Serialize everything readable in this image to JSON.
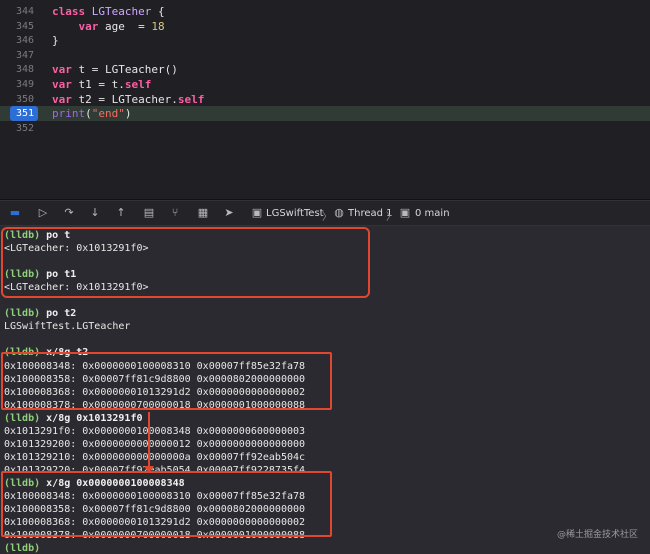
{
  "editor": {
    "lines": [
      {
        "num": "344",
        "tokens": [
          [
            "kw",
            "class "
          ],
          [
            "ty",
            "LGTeacher"
          ],
          [
            "plain",
            " {"
          ]
        ]
      },
      {
        "num": "345",
        "tokens": [
          [
            "plain",
            "    "
          ],
          [
            "kw",
            "var "
          ],
          [
            "plain",
            "age  = "
          ],
          [
            "nm",
            "18"
          ]
        ]
      },
      {
        "num": "346",
        "tokens": [
          [
            "plain",
            "}"
          ]
        ]
      },
      {
        "num": "347",
        "tokens": []
      },
      {
        "num": "348",
        "tokens": [
          [
            "kw",
            "var "
          ],
          [
            "plain",
            "t = LGTeacher()"
          ]
        ]
      },
      {
        "num": "349",
        "tokens": [
          [
            "kw",
            "var "
          ],
          [
            "plain",
            "t1 = t."
          ],
          [
            "kw",
            "self"
          ]
        ]
      },
      {
        "num": "350",
        "tokens": [
          [
            "kw",
            "var "
          ],
          [
            "plain",
            "t2 = LGTeacher."
          ],
          [
            "kw",
            "self"
          ]
        ]
      },
      {
        "num": "351",
        "active": true,
        "tokens": [
          [
            "fn",
            "print"
          ],
          [
            "plain",
            "("
          ],
          [
            "str",
            "\"end\""
          ],
          [
            "plain",
            ")"
          ]
        ]
      },
      {
        "num": "352",
        "tokens": []
      }
    ]
  },
  "debugbar": {
    "target": "LGSwiftTest",
    "thread": "Thread 1",
    "frame": "0 main",
    "sep1": "〉",
    "sep2": "〉"
  },
  "console": {
    "prompt": "(lldb)",
    "lines": [
      {
        "type": "cmd",
        "text": "po t"
      },
      {
        "type": "out",
        "text": "<LGTeacher: 0x1013291f0>"
      },
      {
        "type": "blank",
        "text": ""
      },
      {
        "type": "cmd",
        "text": "po t1"
      },
      {
        "type": "out",
        "text": "<LGTeacher: 0x1013291f0>"
      },
      {
        "type": "blank",
        "text": ""
      },
      {
        "type": "cmd",
        "text": "po t2"
      },
      {
        "type": "out",
        "text": "LGSwiftTest.LGTeacher"
      },
      {
        "type": "blank",
        "text": ""
      },
      {
        "type": "cmd",
        "text": "x/8g t2"
      },
      {
        "type": "out",
        "text": "0x100008348: 0x0000000100008310 0x00007ff85e32fa78"
      },
      {
        "type": "out",
        "text": "0x100008358: 0x00007ff81c9d8800 0x0000802000000000"
      },
      {
        "type": "out",
        "text": "0x100008368: 0x00000001013291d2 0x0000000000000002"
      },
      {
        "type": "out",
        "text": "0x100008378: 0x0000000700000018 0x0000001000000088"
      },
      {
        "type": "cmd",
        "text": "x/8g 0x1013291f0"
      },
      {
        "type": "out",
        "text": "0x1013291f0: 0x0000000100008348 0x0000000600000003"
      },
      {
        "type": "out",
        "text": "0x101329200: 0x0000000000000012 0x0000000000000000"
      },
      {
        "type": "out",
        "text": "0x101329210: 0x000000000000000a 0x00007ff92eab504c"
      },
      {
        "type": "out",
        "text": "0x101329220: 0x00007ff92eab5054 0x00007ff9228735f4"
      },
      {
        "type": "cmd",
        "text": "x/8g 0x0000000100008348"
      },
      {
        "type": "out",
        "text": "0x100008348: 0x0000000100008310 0x00007ff85e32fa78"
      },
      {
        "type": "out",
        "text": "0x100008358: 0x00007ff81c9d8800 0x0000802000000000"
      },
      {
        "type": "out",
        "text": "0x100008368: 0x00000001013291d2 0x0000000000000002"
      },
      {
        "type": "out",
        "text": "0x100008378: 0x0000000700000018 0x0000001000000088"
      },
      {
        "type": "cmd",
        "text": ""
      }
    ]
  },
  "watermark": "@稀土掘金技术社区",
  "colors": {
    "highlight": "#e0472e",
    "prompt": "#8fd17a",
    "active_line": "#2c6ed6"
  }
}
